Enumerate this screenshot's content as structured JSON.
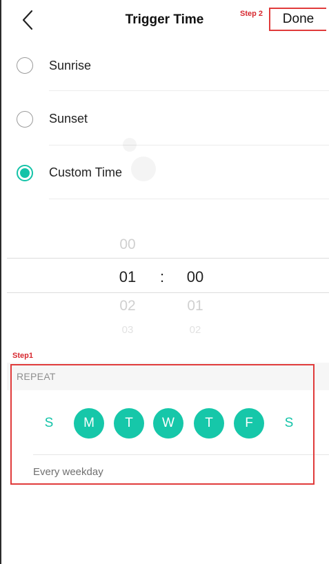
{
  "header": {
    "title": "Trigger Time",
    "done_label": "Done",
    "step2_label": "Step 2"
  },
  "options": [
    {
      "label": "Sunrise",
      "selected": false
    },
    {
      "label": "Sunset",
      "selected": false
    },
    {
      "label": "Custom Time",
      "selected": true
    }
  ],
  "time_picker": {
    "hour_above": "00",
    "hour": "01",
    "hour_below": "02",
    "hour_below2": "03",
    "separator": ":",
    "minute": "00",
    "minute_below": "01",
    "minute_below2": "02"
  },
  "repeat": {
    "step1_label": "Step1",
    "header": "REPEAT",
    "days": [
      {
        "label": "S",
        "active": false
      },
      {
        "label": "M",
        "active": true
      },
      {
        "label": "T",
        "active": true
      },
      {
        "label": "W",
        "active": true
      },
      {
        "label": "T",
        "active": true
      },
      {
        "label": "F",
        "active": true
      },
      {
        "label": "S",
        "active": false
      }
    ],
    "summary": "Every weekday"
  },
  "colors": {
    "accent": "#14c3a8",
    "annotation_red": "#e03a3a"
  }
}
